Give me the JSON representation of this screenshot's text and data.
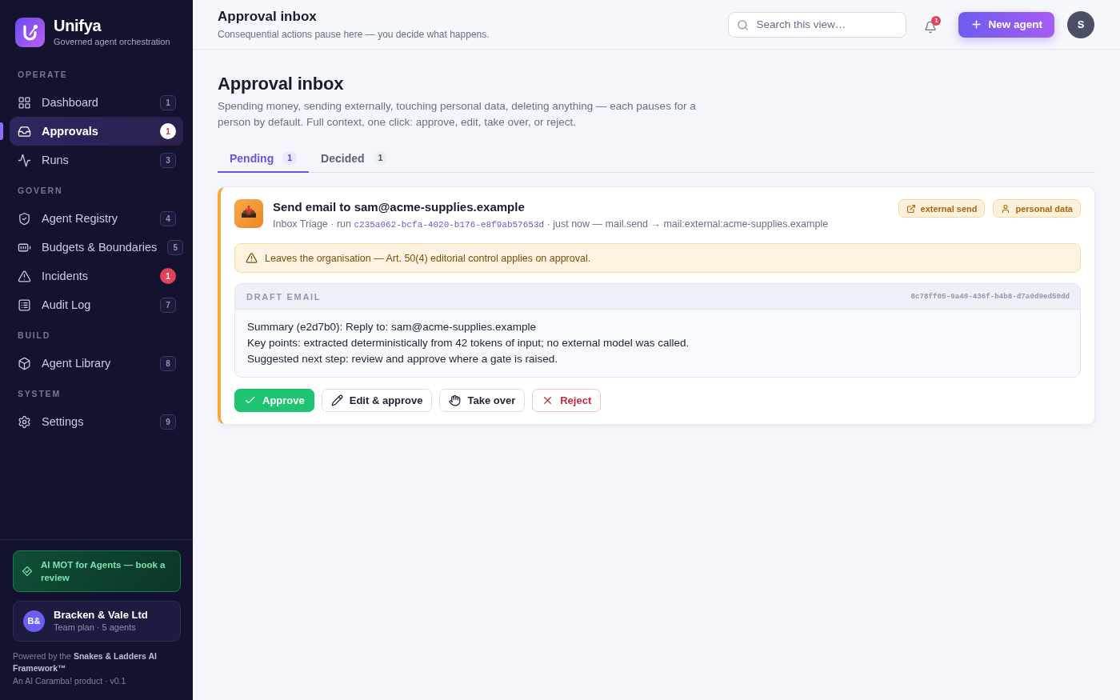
{
  "brand": {
    "name": "Unifya",
    "tagline": "Governed agent orchestration"
  },
  "sidebar": {
    "sections": [
      {
        "label": "OPERATE",
        "items": [
          {
            "label": "Dashboard",
            "badge": "1",
            "alert": false,
            "selected": false
          },
          {
            "label": "Approvals",
            "badge": "1",
            "alert": true,
            "selected": true
          },
          {
            "label": "Runs",
            "badge": "3",
            "alert": false,
            "selected": false
          }
        ]
      },
      {
        "label": "GOVERN",
        "items": [
          {
            "label": "Agent Registry",
            "badge": "4",
            "alert": false,
            "selected": false
          },
          {
            "label": "Budgets & Boundaries",
            "badge": "5",
            "alert": false,
            "selected": false
          },
          {
            "label": "Incidents",
            "badge": "1",
            "alert": true,
            "selected": false
          },
          {
            "label": "Audit Log",
            "badge": "7",
            "alert": false,
            "selected": false
          }
        ]
      },
      {
        "label": "BUILD",
        "items": [
          {
            "label": "Agent Library",
            "badge": "8",
            "alert": false,
            "selected": false
          }
        ]
      },
      {
        "label": "SYSTEM",
        "items": [
          {
            "label": "Settings",
            "badge": "9",
            "alert": false,
            "selected": false
          }
        ]
      }
    ],
    "promo": {
      "text": "AI MOT for Agents — book a review"
    },
    "organisation": {
      "initials": "B&",
      "name": "Bracken & Vale Ltd",
      "plan": "Team plan · 5 agents"
    },
    "footer": {
      "powered_by": "Powered by the **Snakes & Ladders AI Framework™**",
      "product": "An AI Caramba! product · v0.1"
    }
  },
  "header": {
    "title": "Approval inbox",
    "subtitle": "Consequential actions pause here — you decide what happens.",
    "search": {
      "placeholder": "Search this view…"
    },
    "notifications": "1",
    "new_button": "New agent",
    "avatar": "S"
  },
  "page": {
    "title": "Approval inbox",
    "description": "Spending money, sending externally, touching personal data, deleting anything — each pauses for a person by default. Full context, one click: approve, edit, take over, or reject.",
    "tabs": [
      {
        "label": "Pending",
        "count": "1",
        "selected": true
      },
      {
        "label": "Decided",
        "count": "1",
        "selected": false
      }
    ]
  },
  "approvals": [
    {
      "title": "Send email to sam@acme-supplies.example",
      "meta": [
        {
          "kind": "text",
          "text": "Inbox Triage · run"
        },
        {
          "kind": "code",
          "text": "c235a062-bcfa-4020-b176-e8f9ab57653d"
        },
        {
          "kind": "text",
          "text": "· just now — mail.send → mail:external:acme-supplies.example"
        }
      ],
      "tags": [
        {
          "kind": "external_send",
          "label": "external send"
        },
        {
          "kind": "personal_data",
          "label": "personal data"
        }
      ],
      "warning": "Leaves the organisation — Art. 50(4) editorial control applies on approval.",
      "draft": {
        "label": "DRAFT EMAIL",
        "id": "8c78ff05-9a40-436f-b4b8-d7a0d9ed50dd",
        "lines": [
          "Summary (e2d7b0): Reply to: sam@acme-supplies.example",
          "Key points: extracted deterministically from 42 tokens of input; no external model was called.",
          "Suggested next step: review and approve where a gate is raised."
        ]
      },
      "actions": [
        {
          "kind": "approve",
          "label": "Approve"
        },
        {
          "kind": "edit",
          "label": "Edit & approve"
        },
        {
          "kind": "takeover",
          "label": "Take over"
        },
        {
          "kind": "reject",
          "label": "Reject"
        }
      ]
    }
  ]
}
